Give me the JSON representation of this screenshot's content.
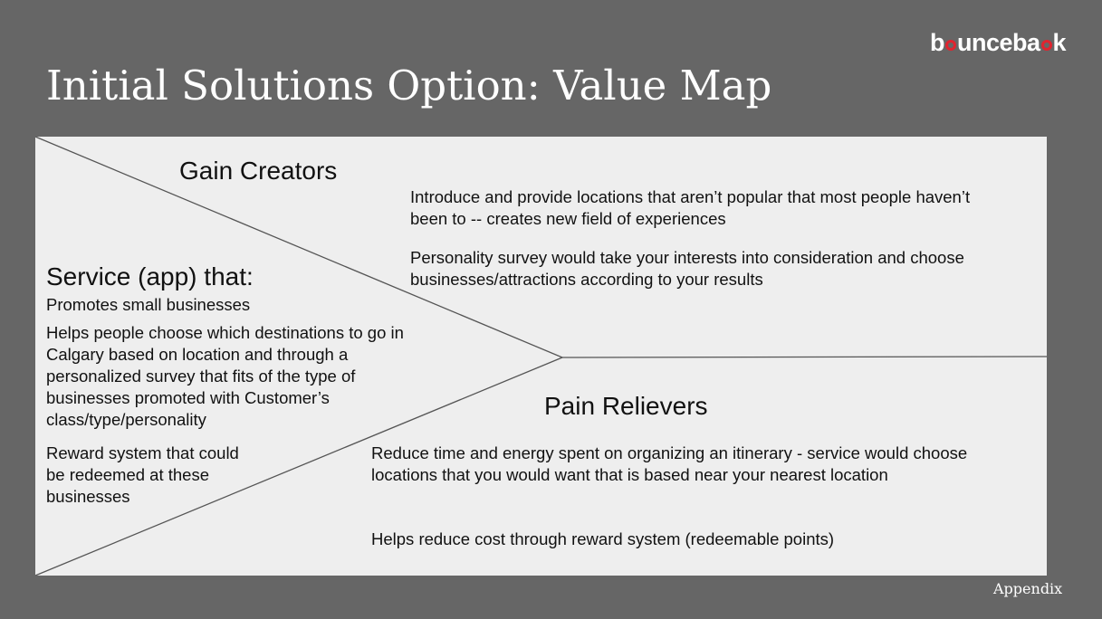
{
  "brand": {
    "logo_prefix": "b",
    "logo_middle": "unceba",
    "logo_suffix": "k"
  },
  "title": "Initial Solutions Option: Value Map",
  "gain_creators": {
    "heading": "Gain Creators",
    "items": [
      "Introduce and provide locations that aren’t popular that most people haven’t been to -- creates new field of experiences",
      "Personality survey would take your interests into consideration and choose businesses/attractions according to your results"
    ]
  },
  "service": {
    "heading": "Service (app) that:",
    "items": [
      "Promotes small businesses",
      "Helps people choose which destinations to go in Calgary based on location and through a personalized survey that fits of the type of businesses promoted with Customer’s class/type/personality",
      "Reward system that could be redeemed at these businesses"
    ]
  },
  "pain_relievers": {
    "heading": "Pain Relievers",
    "items": [
      "Reduce time and energy spent on organizing an itinerary - service would choose locations that you would want that is based near your nearest location",
      "Helps reduce cost through reward system (redeemable points)"
    ]
  },
  "footer": {
    "appendix": "Appendix"
  },
  "colors": {
    "background": "#666666",
    "panel": "#eeeeee",
    "accent": "#e0242f"
  }
}
